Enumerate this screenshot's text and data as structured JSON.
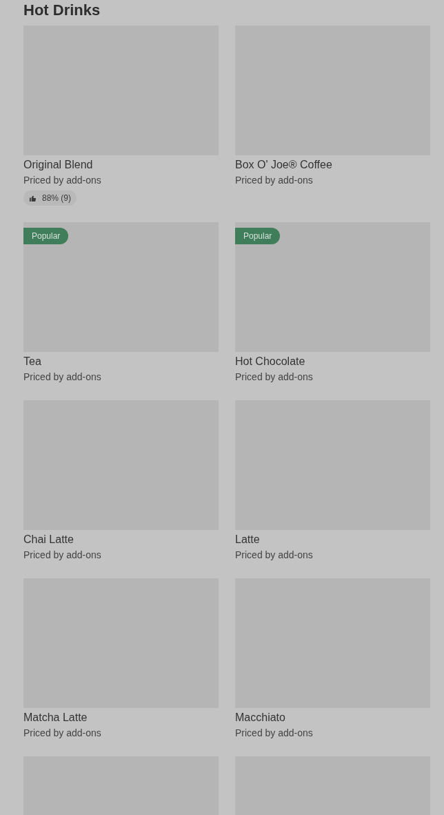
{
  "heading": "Hot Drinks",
  "items": [
    {
      "name": "Original Blend",
      "price_note": "Priced by add-ons",
      "popular": false,
      "rating": "88% (9)"
    },
    {
      "name": "Box O' Joe® Coffee",
      "price_note": "Priced by add-ons",
      "popular": false
    },
    {
      "name": "Tea",
      "price_note": "Priced by add-ons",
      "popular": true,
      "badge": "Popular"
    },
    {
      "name": "Hot Chocolate",
      "price_note": "Priced by add-ons",
      "popular": true,
      "badge": "Popular"
    },
    {
      "name": "Chai Latte",
      "price_note": "Priced by add-ons",
      "popular": false
    },
    {
      "name": "Latte",
      "price_note": "Priced by add-ons",
      "popular": false
    },
    {
      "name": "Matcha Latte",
      "price_note": "Priced by add-ons",
      "popular": false
    },
    {
      "name": "Macchiato",
      "price_note": "Priced by add-ons",
      "popular": false
    },
    {
      "popular": false
    },
    {
      "popular": false
    }
  ]
}
